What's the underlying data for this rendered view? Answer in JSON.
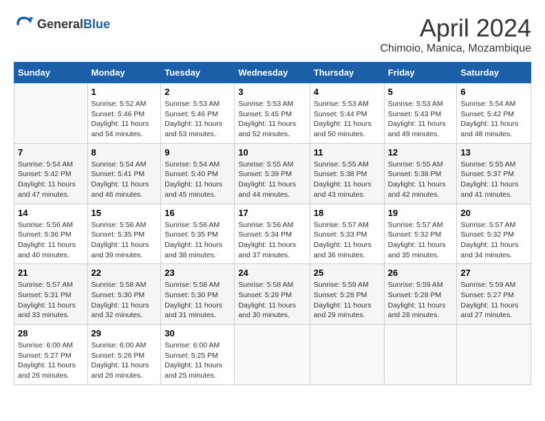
{
  "header": {
    "logo_general": "General",
    "logo_blue": "Blue",
    "title": "April 2024",
    "subtitle": "Chimoio, Manica, Mozambique"
  },
  "columns": [
    "Sunday",
    "Monday",
    "Tuesday",
    "Wednesday",
    "Thursday",
    "Friday",
    "Saturday"
  ],
  "weeks": [
    [
      {
        "day": "",
        "info": ""
      },
      {
        "day": "1",
        "info": "Sunrise: 5:52 AM\nSunset: 5:46 PM\nDaylight: 11 hours\nand 54 minutes."
      },
      {
        "day": "2",
        "info": "Sunrise: 5:53 AM\nSunset: 5:46 PM\nDaylight: 11 hours\nand 53 minutes."
      },
      {
        "day": "3",
        "info": "Sunrise: 5:53 AM\nSunset: 5:45 PM\nDaylight: 11 hours\nand 52 minutes."
      },
      {
        "day": "4",
        "info": "Sunrise: 5:53 AM\nSunset: 5:44 PM\nDaylight: 11 hours\nand 50 minutes."
      },
      {
        "day": "5",
        "info": "Sunrise: 5:53 AM\nSunset: 5:43 PM\nDaylight: 11 hours\nand 49 minutes."
      },
      {
        "day": "6",
        "info": "Sunrise: 5:54 AM\nSunset: 5:42 PM\nDaylight: 11 hours\nand 48 minutes."
      }
    ],
    [
      {
        "day": "7",
        "info": "Sunrise: 5:54 AM\nSunset: 5:42 PM\nDaylight: 11 hours\nand 47 minutes."
      },
      {
        "day": "8",
        "info": "Sunrise: 5:54 AM\nSunset: 5:41 PM\nDaylight: 11 hours\nand 46 minutes."
      },
      {
        "day": "9",
        "info": "Sunrise: 5:54 AM\nSunset: 5:40 PM\nDaylight: 11 hours\nand 45 minutes."
      },
      {
        "day": "10",
        "info": "Sunrise: 5:55 AM\nSunset: 5:39 PM\nDaylight: 11 hours\nand 44 minutes."
      },
      {
        "day": "11",
        "info": "Sunrise: 5:55 AM\nSunset: 5:38 PM\nDaylight: 11 hours\nand 43 minutes."
      },
      {
        "day": "12",
        "info": "Sunrise: 5:55 AM\nSunset: 5:38 PM\nDaylight: 11 hours\nand 42 minutes."
      },
      {
        "day": "13",
        "info": "Sunrise: 5:55 AM\nSunset: 5:37 PM\nDaylight: 11 hours\nand 41 minutes."
      }
    ],
    [
      {
        "day": "14",
        "info": "Sunrise: 5:56 AM\nSunset: 5:36 PM\nDaylight: 11 hours\nand 40 minutes."
      },
      {
        "day": "15",
        "info": "Sunrise: 5:56 AM\nSunset: 5:35 PM\nDaylight: 11 hours\nand 39 minutes."
      },
      {
        "day": "16",
        "info": "Sunrise: 5:56 AM\nSunset: 5:35 PM\nDaylight: 11 hours\nand 38 minutes."
      },
      {
        "day": "17",
        "info": "Sunrise: 5:56 AM\nSunset: 5:34 PM\nDaylight: 11 hours\nand 37 minutes."
      },
      {
        "day": "18",
        "info": "Sunrise: 5:57 AM\nSunset: 5:33 PM\nDaylight: 11 hours\nand 36 minutes."
      },
      {
        "day": "19",
        "info": "Sunrise: 5:57 AM\nSunset: 5:32 PM\nDaylight: 11 hours\nand 35 minutes."
      },
      {
        "day": "20",
        "info": "Sunrise: 5:57 AM\nSunset: 5:32 PM\nDaylight: 11 hours\nand 34 minutes."
      }
    ],
    [
      {
        "day": "21",
        "info": "Sunrise: 5:57 AM\nSunset: 5:31 PM\nDaylight: 11 hours\nand 33 minutes."
      },
      {
        "day": "22",
        "info": "Sunrise: 5:58 AM\nSunset: 5:30 PM\nDaylight: 11 hours\nand 32 minutes."
      },
      {
        "day": "23",
        "info": "Sunrise: 5:58 AM\nSunset: 5:30 PM\nDaylight: 11 hours\nand 31 minutes."
      },
      {
        "day": "24",
        "info": "Sunrise: 5:58 AM\nSunset: 5:29 PM\nDaylight: 11 hours\nand 30 minutes."
      },
      {
        "day": "25",
        "info": "Sunrise: 5:59 AM\nSunset: 5:28 PM\nDaylight: 11 hours\nand 29 minutes."
      },
      {
        "day": "26",
        "info": "Sunrise: 5:59 AM\nSunset: 5:28 PM\nDaylight: 11 hours\nand 28 minutes."
      },
      {
        "day": "27",
        "info": "Sunrise: 5:59 AM\nSunset: 5:27 PM\nDaylight: 11 hours\nand 27 minutes."
      }
    ],
    [
      {
        "day": "28",
        "info": "Sunrise: 6:00 AM\nSunset: 5:27 PM\nDaylight: 11 hours\nand 26 minutes."
      },
      {
        "day": "29",
        "info": "Sunrise: 6:00 AM\nSunset: 5:26 PM\nDaylight: 11 hours\nand 26 minutes."
      },
      {
        "day": "30",
        "info": "Sunrise: 6:00 AM\nSunset: 5:25 PM\nDaylight: 11 hours\nand 25 minutes."
      },
      {
        "day": "",
        "info": ""
      },
      {
        "day": "",
        "info": ""
      },
      {
        "day": "",
        "info": ""
      },
      {
        "day": "",
        "info": ""
      }
    ]
  ]
}
